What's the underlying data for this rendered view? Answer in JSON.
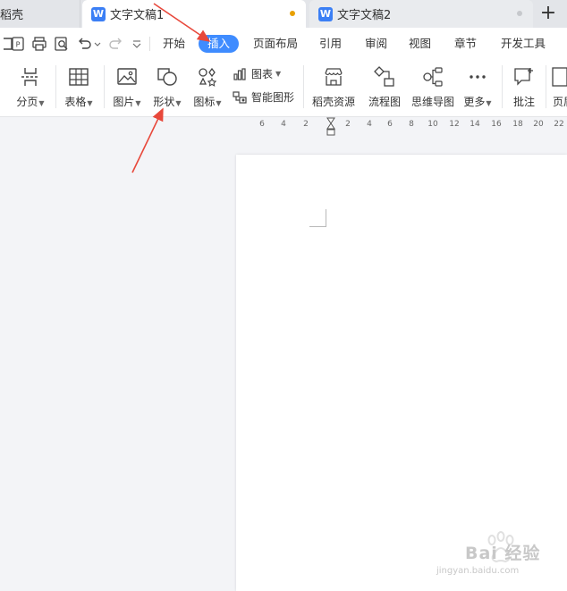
{
  "tabs": {
    "prev_label": "稻壳",
    "active_label": "文字文稿1",
    "active_logo": "W",
    "second_label": "文字文稿2",
    "second_logo": "W",
    "new_tab": "+"
  },
  "menu": {
    "items": [
      "开始",
      "插入",
      "页面布局",
      "引用",
      "审阅",
      "视图",
      "章节",
      "开发工具"
    ],
    "active": "插入"
  },
  "ribbon": {
    "page_break": "分页",
    "table": "表格",
    "picture": "图片",
    "shape": "形状",
    "icon": "图标",
    "chart": "图表",
    "smart_art": "智能图形",
    "docer_resource": "稻壳资源",
    "flowchart": "流程图",
    "mindmap": "思维导图",
    "more": "更多",
    "comment": "批注",
    "header_footer": "页眉"
  },
  "ruler": {
    "left": [
      "6",
      "4",
      "2"
    ],
    "right": [
      "2",
      "4",
      "6",
      "8",
      "10",
      "12",
      "14",
      "16",
      "18",
      "20",
      "22"
    ]
  },
  "watermark": {
    "brand": "Bai 经验",
    "url": "jingyan.baidu.com"
  },
  "colors": {
    "accent": "#3f8cff",
    "doc_logo": "#3b7ff5",
    "annotation_arrow": "#e8483b"
  }
}
